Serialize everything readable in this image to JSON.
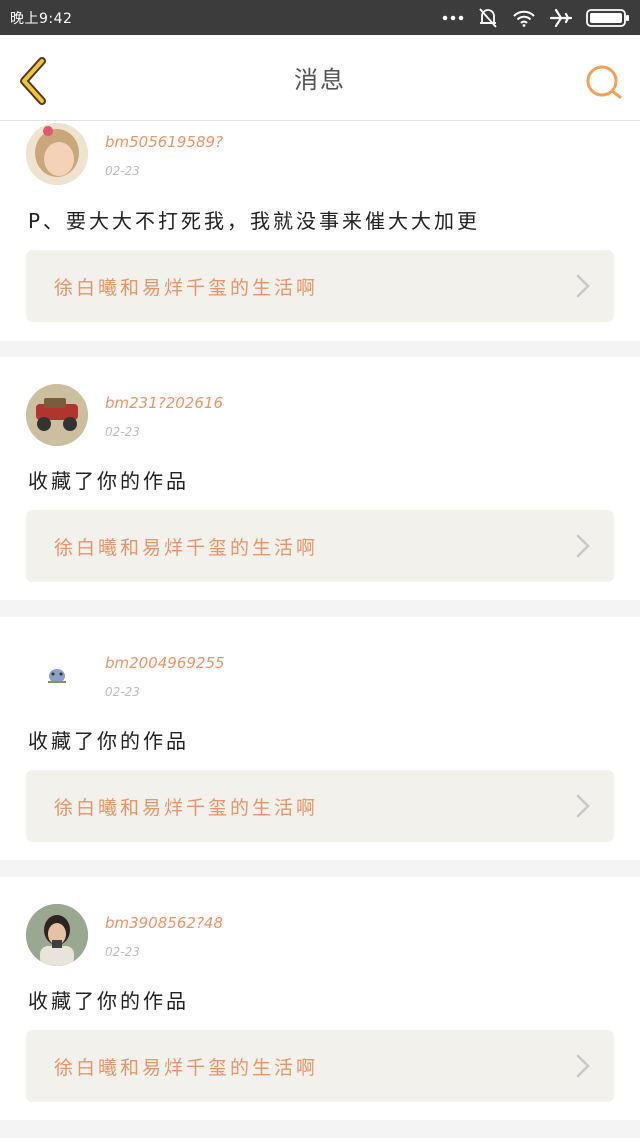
{
  "status_bar": {
    "time": "晚上9:42",
    "icons": [
      "dots-icon",
      "mute-bell-icon",
      "wifi-icon",
      "airplane-icon",
      "battery-icon"
    ]
  },
  "navbar": {
    "title": "消息",
    "back_icon": "chevron-left-icon",
    "search_icon": "search-icon",
    "accent_color": "#f0a25a"
  },
  "messages": [
    {
      "username": "bm505619589?",
      "date": "02-23",
      "text": "P、要大大不打死我，我就没事来催大大加更",
      "work_title": "徐白曦和易烊千玺的生活啊"
    },
    {
      "username": "bm231?202616",
      "date": "02-23",
      "text": "收藏了你的作品",
      "work_title": "徐白曦和易烊千玺的生活啊"
    },
    {
      "username": "bm2004969255",
      "date": "02-23",
      "text": "收藏了你的作品",
      "work_title": "徐白曦和易烊千玺的生活啊"
    },
    {
      "username": "bm3908562?48",
      "date": "02-23",
      "text": "收藏了你的作品",
      "work_title": "徐白曦和易烊千玺的生活啊"
    }
  ]
}
